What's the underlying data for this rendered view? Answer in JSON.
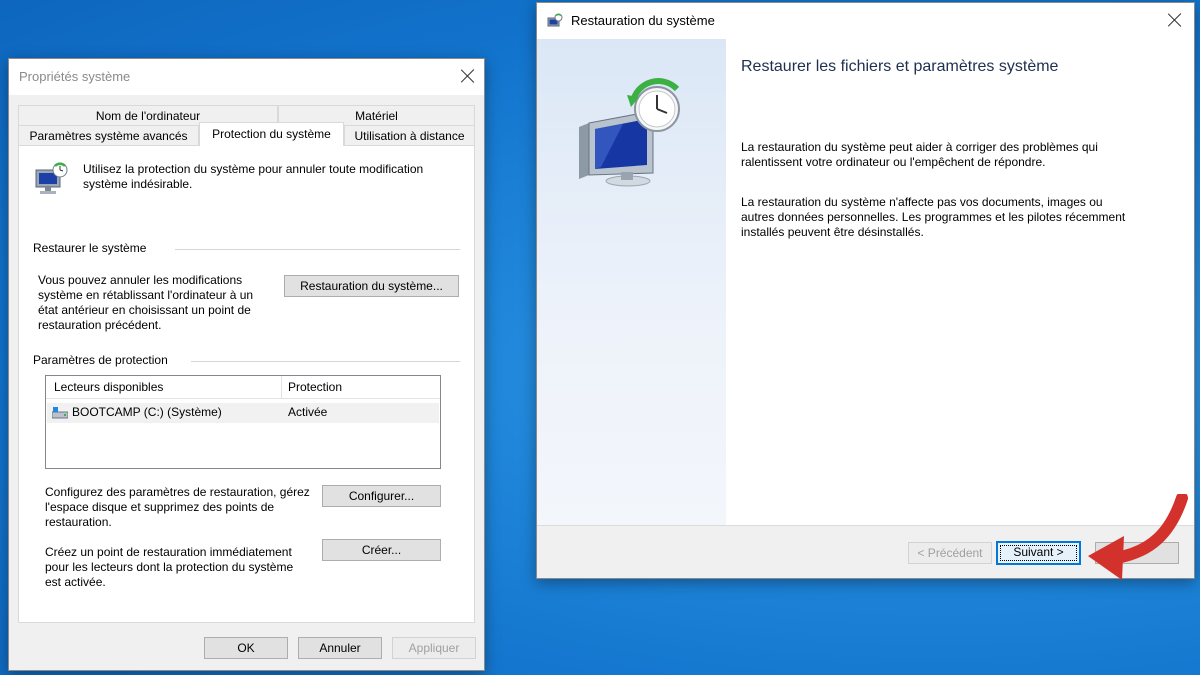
{
  "props_window": {
    "title": "Propriétés système",
    "tabs_row1": [
      "Nom de l'ordinateur",
      "Matériel"
    ],
    "tabs_row2": [
      "Paramètres système avancés",
      "Protection du système",
      "Utilisation à distance"
    ],
    "intro": [
      "Utilisez la protection du système pour annuler toute modification",
      "système indésirable."
    ],
    "restore_group": "Restaurer le système",
    "restore_desc": [
      "Vous pouvez annuler les modifications",
      "système en rétablissant l'ordinateur à un",
      "état antérieur en choisissant un point de",
      "restauration précédent."
    ],
    "restore_button": "Restauration du système...",
    "protection_group": "Paramètres de protection",
    "table_headers": [
      "Lecteurs disponibles",
      "Protection"
    ],
    "drive_name": "BOOTCAMP (C:) (Système)",
    "drive_protection": "Activée",
    "configure_desc": [
      "Configurez des paramètres de restauration, gérez",
      "l'espace disque et supprimez des points de",
      "restauration."
    ],
    "configure_button": "Configurer...",
    "create_desc": [
      "Créez un point de restauration immédiatement",
      "pour les lecteurs dont la protection du système",
      "est activée."
    ],
    "create_button": "Créer...",
    "ok": "OK",
    "cancel": "Annuler",
    "apply": "Appliquer"
  },
  "restore_window": {
    "title": "Restauration du système",
    "heading": "Restaurer les fichiers et paramètres système",
    "para1": [
      "La restauration du système peut aider à corriger des problèmes qui",
      "ralentissent votre ordinateur ou l'empêchent de répondre."
    ],
    "para2": [
      "La restauration du système n'affecte pas vos documents, images ou",
      "autres données personnelles. Les programmes et les pilotes récemment",
      "installés peuvent être désinstallés."
    ],
    "prev_button": "< Précédent",
    "next_button": "Suivant >"
  },
  "colors": {
    "desktop": "#1f86da",
    "accent": "#0078d7",
    "arrow": "#d2322b",
    "sidebar": "#e6eef8"
  }
}
